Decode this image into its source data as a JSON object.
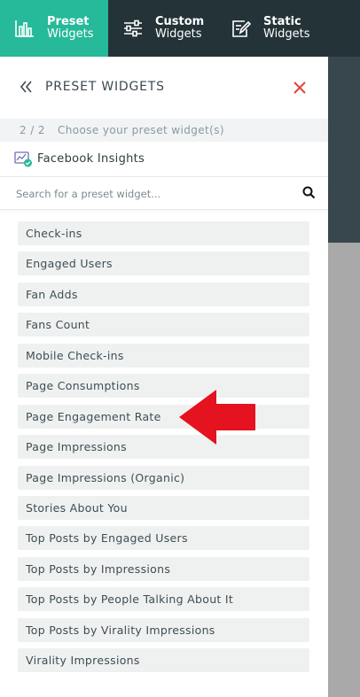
{
  "nav": {
    "tabs": [
      {
        "title": "Preset",
        "subtitle": "Widgets",
        "icon": "bar-chart-icon",
        "active": true
      },
      {
        "title": "Custom",
        "subtitle": "Widgets",
        "icon": "sliders-icon",
        "active": false
      },
      {
        "title": "Static",
        "subtitle": "Widgets",
        "icon": "edit-icon",
        "active": false
      }
    ]
  },
  "panel": {
    "title": "PRESET WIDGETS",
    "step": "2 / 2",
    "step_text": "Choose your preset widget(s)",
    "source": "Facebook Insights",
    "search_placeholder": "Search for a preset widget...",
    "widgets": [
      "Check-ins",
      "Engaged Users",
      "Fan Adds",
      "Fans Count",
      "Mobile Check-ins",
      "Page Consumptions",
      "Page Engagement Rate",
      "Page Impressions",
      "Page Impressions (Organic)",
      "Stories About You",
      "Top Posts by Engaged Users",
      "Top Posts by Impressions",
      "Top Posts by People Talking About It",
      "Top Posts by Virality Impressions",
      "Virality Impressions"
    ]
  },
  "colors": {
    "nav_bg": "#243338",
    "active_tab": "#26b99a",
    "close": "#e0463b",
    "arrow": "#e5121f",
    "item_bg": "#eff1f1"
  }
}
